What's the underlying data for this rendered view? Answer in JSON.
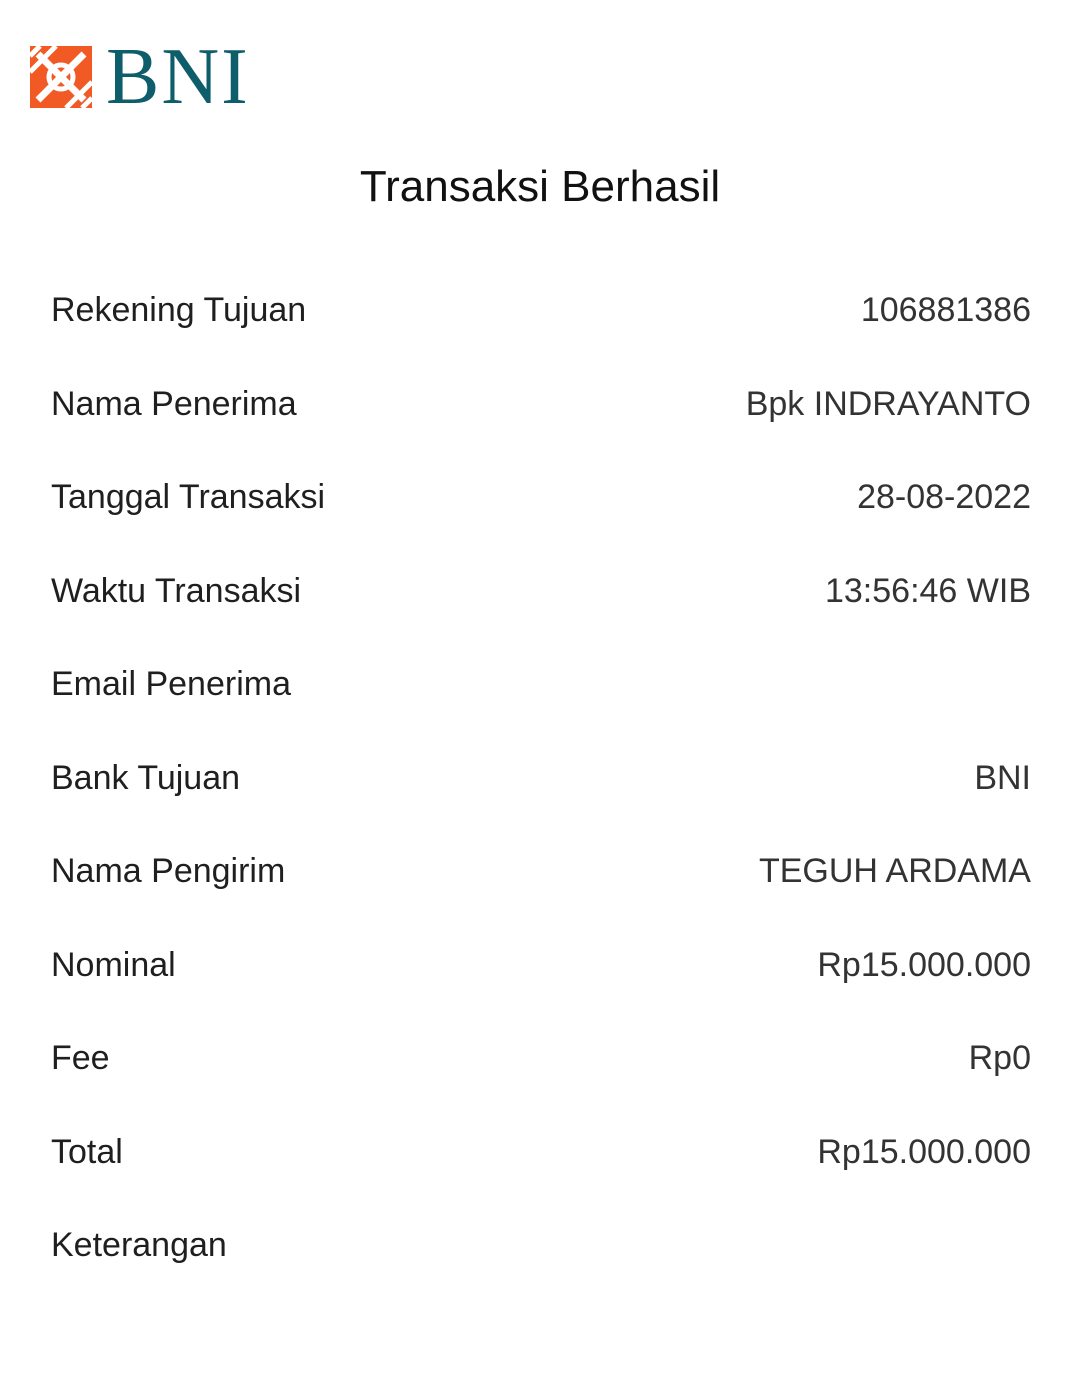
{
  "brand": {
    "logo_text": "BNI",
    "colors": {
      "mark": "#f15a24",
      "text": "#0d5d6b"
    }
  },
  "title": "Transaksi Berhasil",
  "details": [
    {
      "label": "Rekening Tujuan",
      "value": "106881386"
    },
    {
      "label": "Nama Penerima",
      "value": "Bpk INDRAYANTO"
    },
    {
      "label": "Tanggal Transaksi",
      "value": "28-08-2022"
    },
    {
      "label": "Waktu Transaksi",
      "value": "13:56:46 WIB"
    },
    {
      "label": "Email Penerima",
      "value": ""
    },
    {
      "label": "Bank Tujuan",
      "value": "BNI"
    },
    {
      "label": "Nama Pengirim",
      "value": "TEGUH ARDAMA"
    },
    {
      "label": "Nominal",
      "value": "Rp15.000.000"
    },
    {
      "label": "Fee",
      "value": "Rp0"
    },
    {
      "label": "Total",
      "value": "Rp15.000.000"
    },
    {
      "label": "Keterangan",
      "value": ""
    }
  ]
}
